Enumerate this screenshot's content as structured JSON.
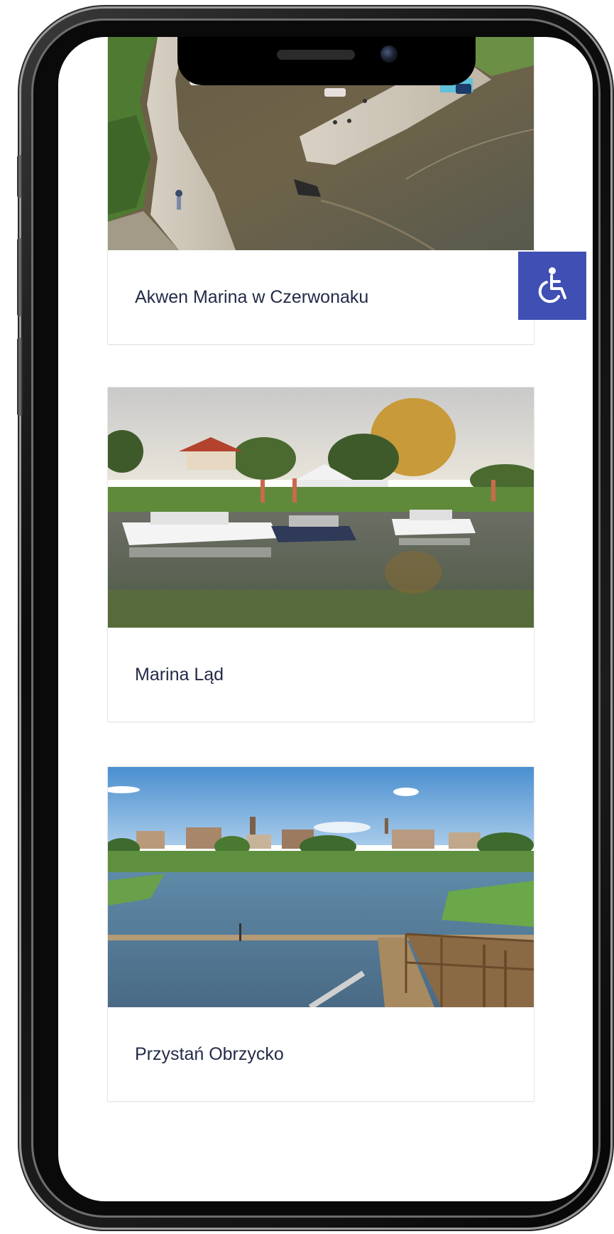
{
  "cards": [
    {
      "title": "Akwen Marina w Czerwonaku",
      "image": "aerial-marina-photo"
    },
    {
      "title": "Marina Ląd",
      "image": "boats-at-marina-photo"
    },
    {
      "title": "Przystań Obrzycko",
      "image": "river-pier-town-photo"
    }
  ],
  "accessibility": {
    "icon": "wheelchair-icon"
  },
  "colors": {
    "title_text": "#232b48",
    "accessibility_bg": "#3f4fb3",
    "screen_bg": "#ffffff"
  }
}
